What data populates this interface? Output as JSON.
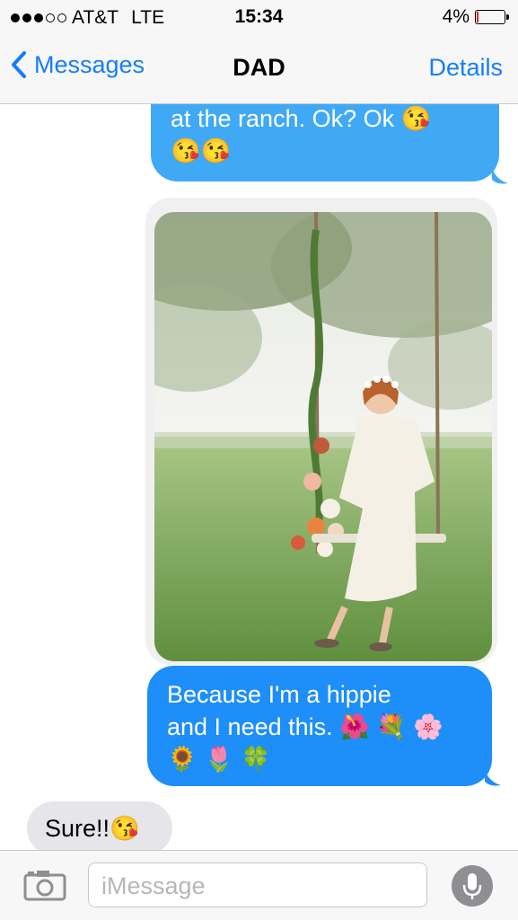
{
  "status_bar": {
    "carrier": "AT&T",
    "network": "LTE",
    "time": "15:34",
    "battery": "4%",
    "battery_level": 0.04,
    "signal_bars_filled": 3,
    "signal_bars_total": 5
  },
  "nav": {
    "back_label": "Messages",
    "title": "DAD",
    "details_label": "Details"
  },
  "messages": [
    {
      "direction": "outgoing",
      "text": "at the ranch. Ok? Ok 😘",
      "text_line2": "😘😘"
    },
    {
      "direction": "outgoing",
      "type": "image",
      "image_icon": "photo-of-woman-on-flower-swing"
    },
    {
      "direction": "outgoing",
      "line1": "Because I'm a hippie",
      "line2": "and I need this. 🌺 💐 🌸",
      "line3": "🌻 🌷 🍀"
    },
    {
      "direction": "incoming",
      "text": "Sure!!😘"
    }
  ],
  "input": {
    "placeholder": "iMessage",
    "camera_icon": "camera-icon",
    "mic_icon": "microphone-icon"
  },
  "colors": {
    "accent": "#147efb",
    "outgoing_bubble": "#1e8ef8",
    "incoming_bubble": "#e5e5ea",
    "battery_low": "#e0251f"
  }
}
